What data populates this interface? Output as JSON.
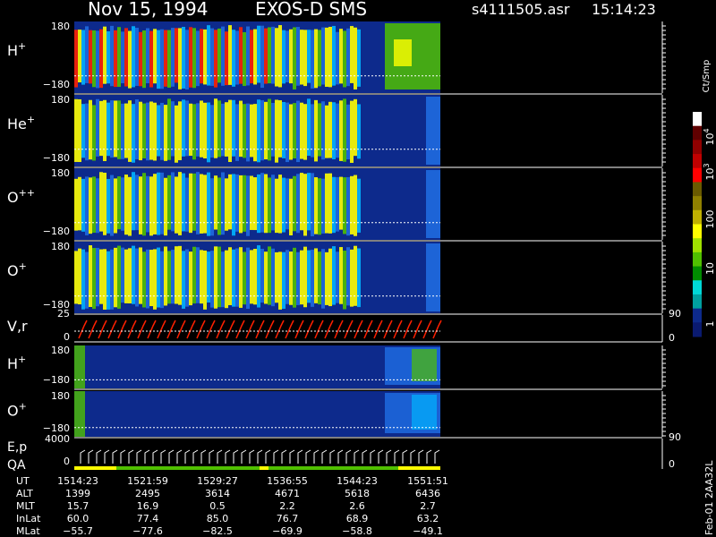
{
  "header": {
    "date": "Nov 15, 1994",
    "instrument": "EXOS-D SMS",
    "filename": "s4111505.asr",
    "time": "15:14:23"
  },
  "chart_data": {
    "type": "heatmap",
    "panels": [
      {
        "id": "h_plus",
        "species": "H",
        "charge": "+",
        "ymax": "180",
        "ymin": "−180"
      },
      {
        "id": "he_plus",
        "species": "He",
        "charge": "+",
        "ymax": "180",
        "ymin": "−180"
      },
      {
        "id": "o_plusplus",
        "species": "O",
        "charge": "++",
        "ymax": "180",
        "ymin": "−180"
      },
      {
        "id": "o_plus",
        "species": "O",
        "charge": "+",
        "ymax": "180",
        "ymin": "−180"
      }
    ],
    "vr_panel": {
      "label": "V,r",
      "left_top": "25",
      "left_bottom": "0",
      "right_top": "90",
      "right_bottom": "0"
    },
    "low_panels": [
      {
        "id": "h_plus_2",
        "species": "H",
        "charge": "+",
        "ymax": "180",
        "ymin": "−180"
      },
      {
        "id": "o_plus_2",
        "species": "O",
        "charge": "+",
        "ymax": "180",
        "ymin": "−180"
      }
    ],
    "ep_panel": {
      "label": "E,p",
      "label2": "QA",
      "left_top": "4000",
      "left_bottom": "0",
      "right_top": "90",
      "right_bottom": "0"
    },
    "colorbar": {
      "unit": "Ct/Smp",
      "tick_labels": [
        {
          "label": "10",
          "exp": "4"
        },
        {
          "label": "10",
          "exp": "3"
        },
        {
          "label": "100",
          "exp": ""
        },
        {
          "label": "10",
          "exp": ""
        },
        {
          "label": "1",
          "exp": ""
        }
      ],
      "colors": [
        "#ffffff",
        "#600000",
        "#900000",
        "#c00000",
        "#ff0000",
        "#6a5a00",
        "#908000",
        "#c0b000",
        "#ffff00",
        "#a0e000",
        "#50c000",
        "#008c00",
        "#00d8d8",
        "#00a0a0",
        "#0d2a8c",
        "#0a1a70"
      ]
    },
    "spectrogram_colors": {
      "bg": "#0d2a8c",
      "low": "#1f6adf",
      "mid": "#00b4ff",
      "cyan": "#00d8d8",
      "green": "#50c000",
      "yellow": "#ffff00",
      "orange": "#e0a000",
      "red": "#ff2000"
    },
    "orbit_table": {
      "row_labels": [
        "UT",
        "ALT",
        "MLT",
        "InLat",
        "MLat"
      ],
      "columns": [
        {
          "UT": "1514:23",
          "ALT": "1399",
          "MLT": "15.7",
          "InLat": "60.0",
          "MLat": "−55.7"
        },
        {
          "UT": "1521:59",
          "ALT": "2495",
          "MLT": "16.9",
          "InLat": "77.4",
          "MLat": "−77.6"
        },
        {
          "UT": "1529:27",
          "ALT": "3614",
          "MLT": "0.5",
          "InLat": "85.0",
          "MLat": "−82.5"
        },
        {
          "UT": "1536:55",
          "ALT": "4671",
          "MLT": "2.2",
          "InLat": "76.7",
          "MLat": "−69.9"
        },
        {
          "UT": "1544:23",
          "ALT": "5618",
          "MLT": "2.6",
          "InLat": "68.9",
          "MLat": "−58.8"
        },
        {
          "UT": "1551:51",
          "ALT": "6436",
          "MLT": "2.7",
          "InLat": "63.2",
          "MLat": "−49.1"
        }
      ]
    },
    "footer_note": "Feb-01 2AA32L"
  }
}
